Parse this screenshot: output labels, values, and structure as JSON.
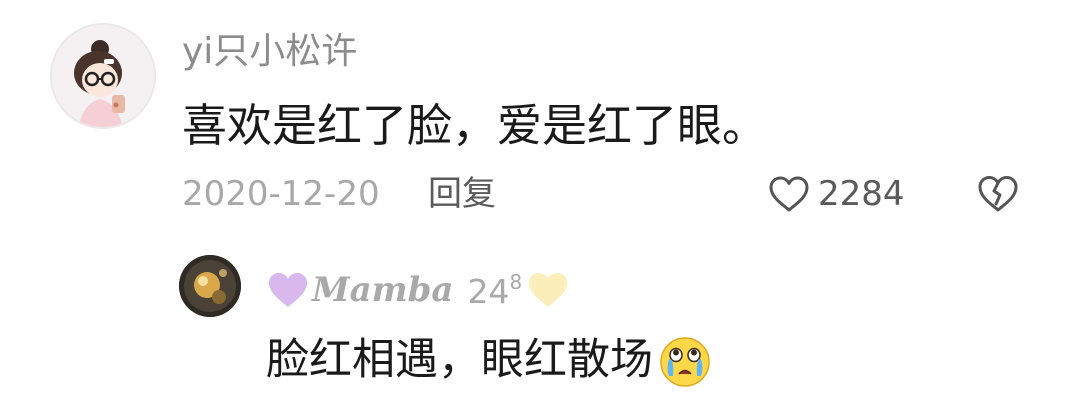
{
  "comment": {
    "username": "yi只小松许",
    "text": "喜欢是红了脸，爱是红了眼。",
    "date": "2020-12-20",
    "reply_label": "回复",
    "like_count": "2284",
    "icons": {
      "avatar": "avatar",
      "like": "heart-outline-icon",
      "dislike": "broken-heart-icon"
    }
  },
  "reply": {
    "username": "Mamba",
    "username_number": "24",
    "username_superscript": "8",
    "text": "脸红相遇，眼红散场",
    "icons": {
      "left": "purple-heart-icon",
      "right": "yellow-heart-icon",
      "emoji": "crying-face-emoji"
    },
    "colors": {
      "left_heart": "#d9b8ee",
      "right_heart": "#fbeebb"
    }
  }
}
